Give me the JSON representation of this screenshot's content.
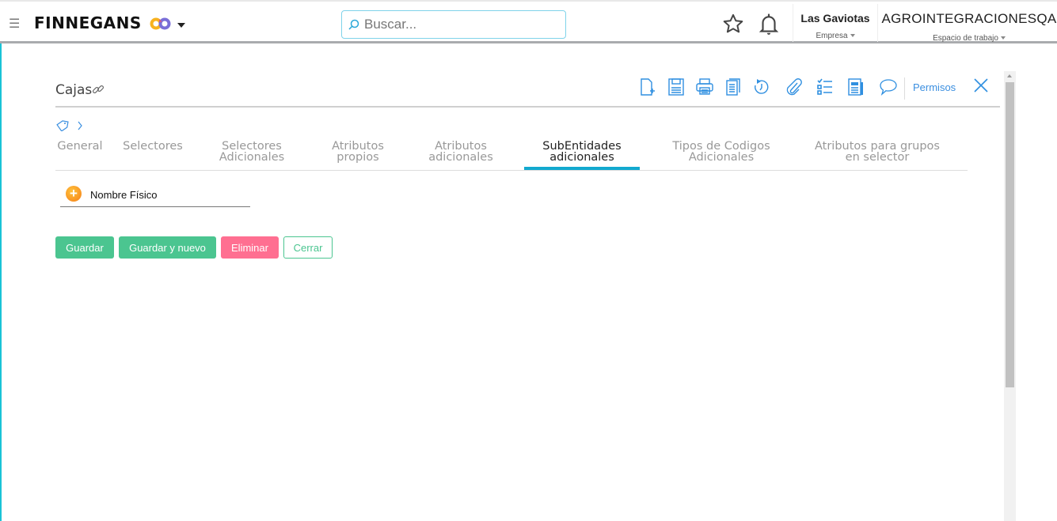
{
  "header": {
    "brand": "FINNEGANS",
    "search_placeholder": "Buscar...",
    "company_name": "Las Gaviotas",
    "company_label": "Empresa",
    "workspace_name": "AGROINTEGRACIONESQA",
    "workspace_label": "Espacio de trabajo"
  },
  "page": {
    "title": "Cajas",
    "permissions_label": "Permisos",
    "toolbar_icons": [
      "new-document-icon",
      "save-icon",
      "print-icon",
      "copy-icon",
      "history-icon",
      "attachment-icon",
      "checklist-icon",
      "report-icon",
      "comment-icon"
    ]
  },
  "tabs": [
    {
      "label": "General"
    },
    {
      "label": "Selectores"
    },
    {
      "label": "Selectores\nAdicionales"
    },
    {
      "label": "Atributos\npropios"
    },
    {
      "label": "Atributos\nadicionales"
    },
    {
      "label": "SubEntidades\nadicionales",
      "active": true
    },
    {
      "label": "Tipos de Codigos\nAdicionales"
    },
    {
      "label": "Atributos para grupos\nen selector"
    }
  ],
  "form": {
    "field_label": "Nombre Físico"
  },
  "buttons": {
    "save": "Guardar",
    "save_new": "Guardar y nuevo",
    "delete": "Eliminar",
    "close": "Cerrar"
  },
  "colors": {
    "accent": "#12a9cf",
    "green": "#4bc590",
    "pink": "#ff6f91",
    "blue": "#3b8fe0"
  }
}
